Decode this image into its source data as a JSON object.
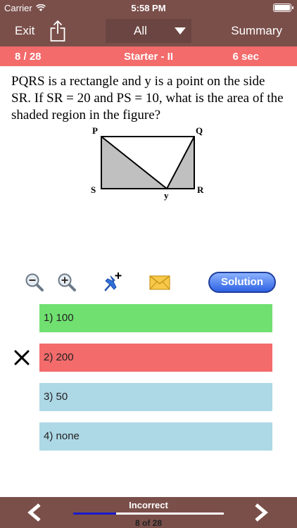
{
  "status_bar": {
    "carrier": "Carrier",
    "time": "5:58 PM"
  },
  "nav": {
    "exit_label": "Exit",
    "filter": {
      "selected": "All"
    },
    "summary_label": "Summary"
  },
  "info_bar": {
    "count": "8 / 28",
    "section": "Starter - II",
    "timer": "6 sec"
  },
  "question": {
    "text": "PQRS is a rectangle and y is a point on the side SR. If SR = 20 and PS = 10, what is the area of the shaded region in the figure?",
    "figure_labels": {
      "p": "P",
      "q": "Q",
      "s": "S",
      "r": "R",
      "y": "y"
    }
  },
  "toolbar": {
    "icons": [
      "zoom-out-icon",
      "zoom-in-icon",
      "pin-add-icon",
      "mail-icon"
    ],
    "solution_label": "Solution"
  },
  "options": [
    {
      "label": "1) 100",
      "state": "correct"
    },
    {
      "label": "2) 200",
      "state": "wrong"
    },
    {
      "label": "3) 50",
      "state": "neutral"
    },
    {
      "label": "4) none",
      "state": "neutral"
    }
  ],
  "footer": {
    "result": "Incorrect",
    "position": "8 of 28",
    "progress": 0.2857
  },
  "colors": {
    "header_bg": "#7a4f4a",
    "info_bar_bg": "#f36b6b",
    "correct": "#70e070",
    "wrong": "#f36b6b",
    "neutral": "#add8e6"
  }
}
